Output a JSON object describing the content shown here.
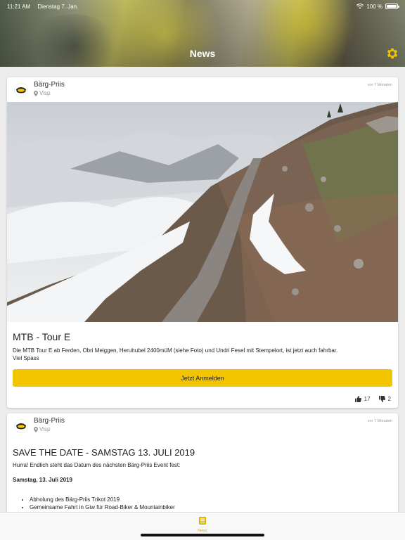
{
  "status_bar": {
    "time": "11:21 AM",
    "date": "Dienstag 7. Jan.",
    "battery": "100 %"
  },
  "header": {
    "title": "News"
  },
  "posts": [
    {
      "author": "Bärg-Priis",
      "location": "Visp",
      "time": "vor 7 Monaten",
      "title": "MTB - Tour E",
      "body_line1": "Die MTB Tour E ab Ferden, Obri Meiggen, Heruhubel 2400müM (siehe Foto) und Undri Fesel mit Stempelort, ist jetzt auch fahrbar.",
      "body_line2": "Viel Spass",
      "button_label": "Jetzt Anmelden",
      "likes": "17",
      "dislikes": "2"
    },
    {
      "author": "Bärg-Priis",
      "location": "Visp",
      "time": "vor 7 Monaten",
      "title": "SAVE THE DATE - SAMSTAG 13. JULI 2019",
      "intro": "Hurra! Endlich steht das Datum des nächsten Bärg-Priis Event fest:",
      "date_line": "Samstag, 13. Juli 2019",
      "list": [
        "Abholung des Bärg-Priis Trikot 2019",
        "Gemeinsame Fahrt in Giw für Road-Biker & Mountainbiker"
      ]
    }
  ],
  "tabbar": {
    "news_label": "News"
  },
  "colors": {
    "accent": "#f2c500",
    "tab_active": "#d6a800"
  }
}
